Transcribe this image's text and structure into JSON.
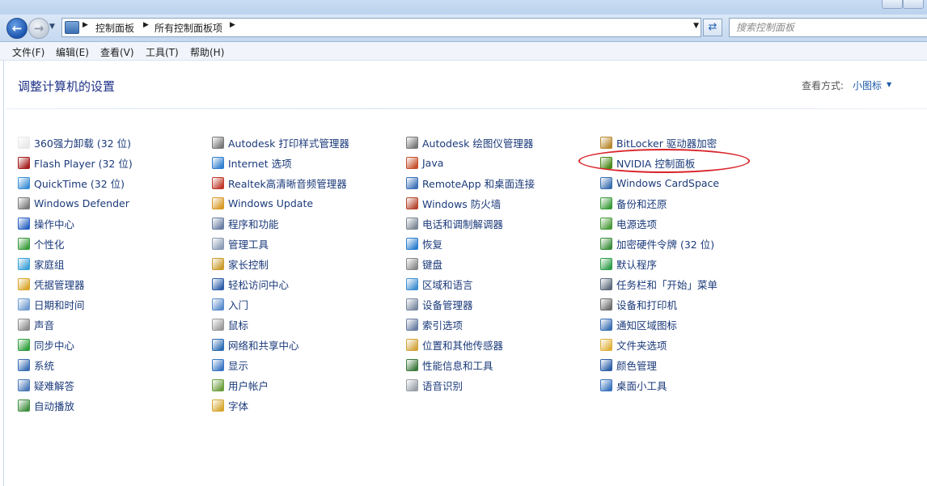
{
  "navigation": {
    "breadcrumbs": [
      "控制面板",
      "所有控制面板项"
    ],
    "search_placeholder": "搜索控制面板"
  },
  "menu": [
    "文件(F)",
    "编辑(E)",
    "查看(V)",
    "工具(T)",
    "帮助(H)"
  ],
  "header": {
    "title": "调整计算机的设置",
    "view_label": "查看方式:",
    "view_value": "小图标"
  },
  "columns": [
    [
      {
        "label": "360强力卸载 (32 位)",
        "icon": "uninstall-icon",
        "color": "#e8e8e8"
      },
      {
        "label": "Flash Player (32 位)",
        "icon": "flash-icon",
        "color": "#a61e1e"
      },
      {
        "label": "QuickTime (32 位)",
        "icon": "quicktime-icon",
        "color": "#3d8fd6"
      },
      {
        "label": "Windows Defender",
        "icon": "defender-icon",
        "color": "#7a7a7a"
      },
      {
        "label": "操作中心",
        "icon": "flag-icon",
        "color": "#2a63c2"
      },
      {
        "label": "个性化",
        "icon": "personalize-icon",
        "color": "#3b9c3b"
      },
      {
        "label": "家庭组",
        "icon": "homegroup-icon",
        "color": "#3aa0d8"
      },
      {
        "label": "凭据管理器",
        "icon": "credential-icon",
        "color": "#d9a62b"
      },
      {
        "label": "日期和时间",
        "icon": "clock-icon",
        "color": "#6f9bd1"
      },
      {
        "label": "声音",
        "icon": "speaker-icon",
        "color": "#8c8c8c"
      },
      {
        "label": "同步中心",
        "icon": "sync-icon",
        "color": "#2e9e3a"
      },
      {
        "label": "系统",
        "icon": "system-icon",
        "color": "#3b6fb3"
      },
      {
        "label": "疑难解答",
        "icon": "troubleshoot-icon",
        "color": "#4b79b8"
      },
      {
        "label": "自动播放",
        "icon": "autoplay-icon",
        "color": "#3f8f3f"
      }
    ],
    [
      {
        "label": "Autodesk 打印样式管理器",
        "icon": "printer-style-icon",
        "color": "#777777"
      },
      {
        "label": "Internet 选项",
        "icon": "internet-icon",
        "color": "#2f7fcf"
      },
      {
        "label": "Realtek高清晰音频管理器",
        "icon": "audio-manager-icon",
        "color": "#c0392b"
      },
      {
        "label": "Windows Update",
        "icon": "windows-update-icon",
        "color": "#d89a26"
      },
      {
        "label": "程序和功能",
        "icon": "programs-icon",
        "color": "#6a7ea3"
      },
      {
        "label": "管理工具",
        "icon": "admin-tools-icon",
        "color": "#8a9bb5"
      },
      {
        "label": "家长控制",
        "icon": "parental-icon",
        "color": "#c99a2a"
      },
      {
        "label": "轻松访问中心",
        "icon": "accessibility-icon",
        "color": "#2f5fa8"
      },
      {
        "label": "入门",
        "icon": "getting-started-icon",
        "color": "#5a8ccc"
      },
      {
        "label": "鼠标",
        "icon": "mouse-icon",
        "color": "#9a9a9a"
      },
      {
        "label": "网络和共享中心",
        "icon": "network-icon",
        "color": "#2e6db5"
      },
      {
        "label": "显示",
        "icon": "display-icon",
        "color": "#3a76c4"
      },
      {
        "label": "用户帐户",
        "icon": "user-accounts-icon",
        "color": "#6b9f3c"
      },
      {
        "label": "字体",
        "icon": "fonts-icon",
        "color": "#d6a62e"
      }
    ],
    [
      {
        "label": "Autodesk 绘图仪管理器",
        "icon": "plotter-icon",
        "color": "#777777"
      },
      {
        "label": "Java",
        "icon": "java-icon",
        "color": "#c6502b"
      },
      {
        "label": "RemoteApp 和桌面连接",
        "icon": "remote-app-icon",
        "color": "#3c72b8"
      },
      {
        "label": "Windows 防火墙",
        "icon": "firewall-icon",
        "color": "#b5462e"
      },
      {
        "label": "电话和调制解调器",
        "icon": "phone-modem-icon",
        "color": "#7b8794"
      },
      {
        "label": "恢复",
        "icon": "recovery-icon",
        "color": "#2f7fcf"
      },
      {
        "label": "键盘",
        "icon": "keyboard-icon",
        "color": "#8a8a8a"
      },
      {
        "label": "区域和语言",
        "icon": "region-icon",
        "color": "#3f8fd0"
      },
      {
        "label": "设备管理器",
        "icon": "device-manager-icon",
        "color": "#7a8aa0"
      },
      {
        "label": "索引选项",
        "icon": "indexing-icon",
        "color": "#6a7ea3"
      },
      {
        "label": "位置和其他传感器",
        "icon": "sensor-icon",
        "color": "#d2a43a"
      },
      {
        "label": "性能信息和工具",
        "icon": "performance-icon",
        "color": "#3c7a3c"
      },
      {
        "label": "语音识别",
        "icon": "microphone-icon",
        "color": "#9aa0a8"
      }
    ],
    [
      {
        "label": "BitLocker 驱动器加密",
        "icon": "bitlocker-icon",
        "color": "#b8892e"
      },
      {
        "label": "NVIDIA 控制面板",
        "icon": "nvidia-icon",
        "color": "#4a8a1c"
      },
      {
        "label": "Windows CardSpace",
        "icon": "cardspace-icon",
        "color": "#3a6fb0"
      },
      {
        "label": "备份和还原",
        "icon": "backup-icon",
        "color": "#3b9c3b"
      },
      {
        "label": "电源选项",
        "icon": "power-icon",
        "color": "#4a9a3a"
      },
      {
        "label": "加密硬件令牌 (32 位)",
        "icon": "token-icon",
        "color": "#3d8f3d"
      },
      {
        "label": "默认程序",
        "icon": "default-programs-icon",
        "color": "#2f9e4a"
      },
      {
        "label": "任务栏和「开始」菜单",
        "icon": "taskbar-icon",
        "color": "#5d6b7c"
      },
      {
        "label": "设备和打印机",
        "icon": "devices-printers-icon",
        "color": "#6e6e6e"
      },
      {
        "label": "通知区域图标",
        "icon": "notification-icon",
        "color": "#3b6fb3"
      },
      {
        "label": "文件夹选项",
        "icon": "folder-options-icon",
        "color": "#e0b13c"
      },
      {
        "label": "颜色管理",
        "icon": "color-management-icon",
        "color": "#2e5fa8"
      },
      {
        "label": "桌面小工具",
        "icon": "gadgets-icon",
        "color": "#3a74bf"
      }
    ]
  ]
}
